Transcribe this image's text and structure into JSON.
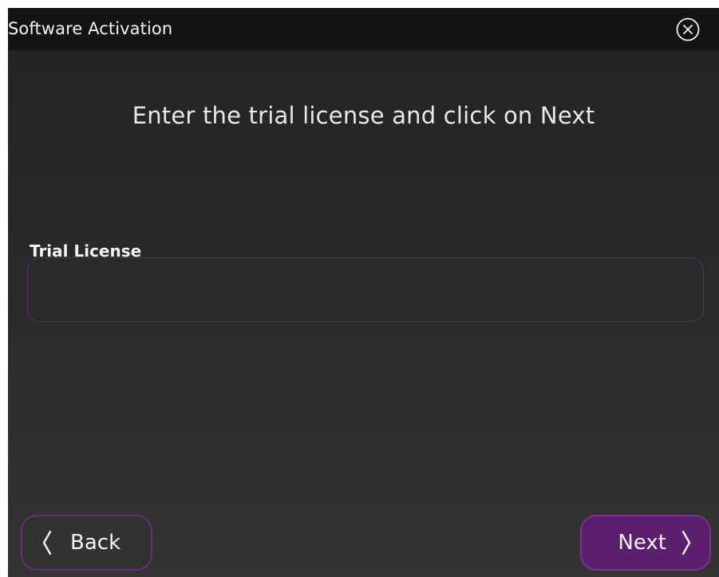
{
  "window": {
    "title": "Software Activation",
    "close_icon": "close-circle-icon"
  },
  "main": {
    "heading": "Enter the trial license and click on Next",
    "license_field": {
      "label": "Trial License",
      "value": "",
      "placeholder": ""
    }
  },
  "footer": {
    "back_label": "Back",
    "back_icon": "chevron-left-icon",
    "next_label": "Next",
    "next_icon": "chevron-right-icon"
  },
  "colors": {
    "accent": "#5c1f6d",
    "accent_border": "#6b2d7a",
    "titlebar": "#131313",
    "background": "#2b2b2b"
  }
}
